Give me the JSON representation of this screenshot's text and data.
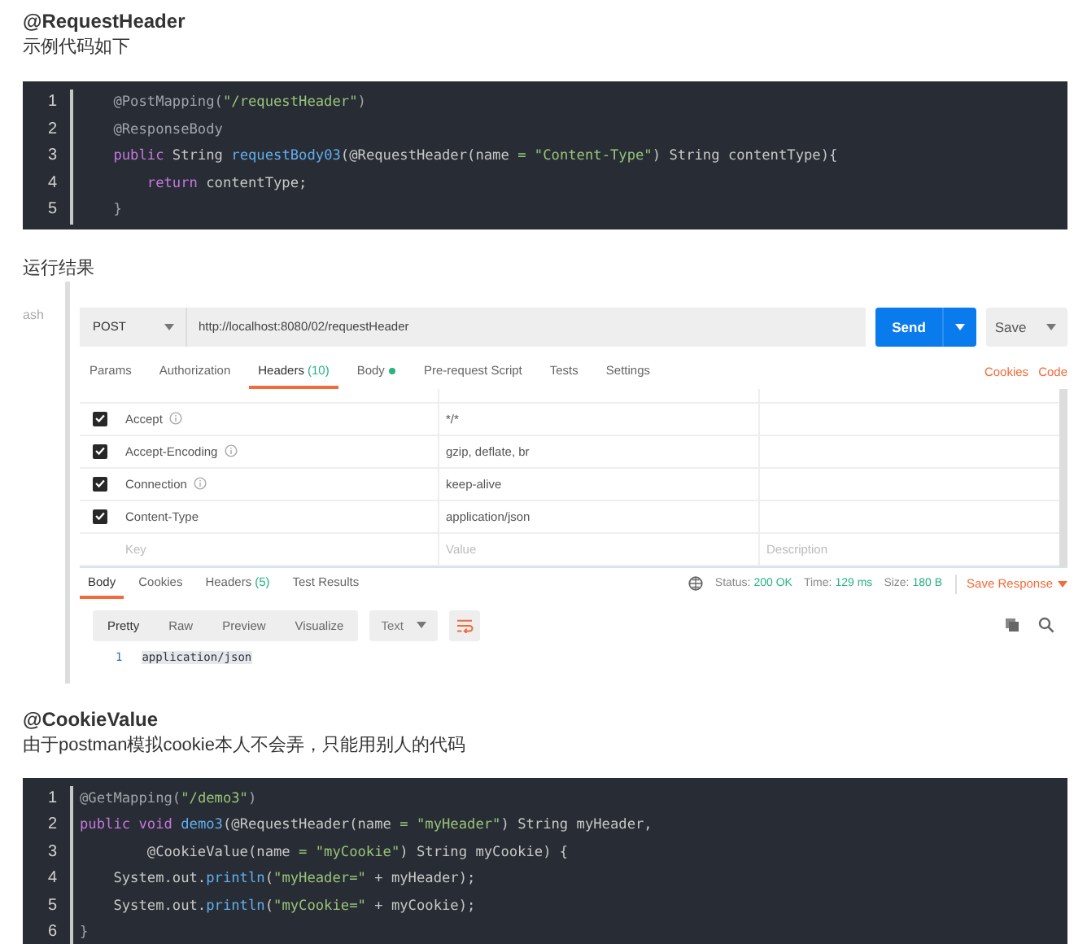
{
  "section1": {
    "heading": "@RequestHeader",
    "intro": "示例代码如下",
    "code": [
      {
        "n": "1",
        "tokens": [
          {
            "t": "    @PostMapping(",
            "kind": "annotation"
          },
          {
            "t": "\"/requestHeader\"",
            "kind": "string"
          },
          {
            "t": ")",
            "kind": "annotation"
          }
        ]
      },
      {
        "n": "2",
        "tokens": [
          {
            "t": "    @ResponseBody",
            "kind": "annotation"
          }
        ]
      },
      {
        "n": "3",
        "tokens": [
          {
            "t": "    public",
            "kind": "keyword"
          },
          {
            "t": " String ",
            "kind": "plain"
          },
          {
            "t": "requestBody03",
            "kind": "func"
          },
          {
            "t": "(@RequestHeader(name ",
            "kind": "plain"
          },
          {
            "t": "= \"Content-Type\"",
            "kind": "string"
          },
          {
            "t": ") String contentType){",
            "kind": "plain"
          }
        ]
      },
      {
        "n": "4",
        "tokens": [
          {
            "t": "        return",
            "kind": "keyword"
          },
          {
            "t": " contentType;",
            "kind": "plain"
          }
        ]
      },
      {
        "n": "5",
        "tokens": [
          {
            "t": "    }",
            "kind": "annotation"
          }
        ]
      }
    ]
  },
  "result_label": "运行结果",
  "postman": {
    "sidebar_text": "ash",
    "method": "POST",
    "url": "http://localhost:8080/02/requestHeader",
    "send": "Send",
    "save": "Save",
    "request_tabs": [
      {
        "label": "Params",
        "selected": false
      },
      {
        "label": "Authorization",
        "selected": false
      },
      {
        "label": "Headers",
        "count": "(10)",
        "selected": true
      },
      {
        "label": "Body",
        "dot": true,
        "selected": false
      },
      {
        "label": "Pre-request Script",
        "selected": false
      },
      {
        "label": "Tests",
        "selected": false
      },
      {
        "label": "Settings",
        "selected": false
      }
    ],
    "links": [
      "Cookies",
      "Code"
    ],
    "headers": [
      {
        "key": "Accept",
        "info": true,
        "value": "*/*",
        "checked": true
      },
      {
        "key": "Accept-Encoding",
        "info": true,
        "value": "gzip, deflate, br",
        "checked": true
      },
      {
        "key": "Connection",
        "info": true,
        "value": "keep-alive",
        "checked": true
      },
      {
        "key": "Content-Type",
        "info": false,
        "value": "application/json",
        "checked": true
      }
    ],
    "new_row": {
      "key_placeholder": "Key",
      "value_placeholder": "Value",
      "description_placeholder": "Description"
    },
    "response_tabs": [
      {
        "label": "Body",
        "selected": true
      },
      {
        "label": "Cookies",
        "selected": false
      },
      {
        "label": "Headers",
        "count": "(5)",
        "selected": false
      },
      {
        "label": "Test Results",
        "selected": false
      }
    ],
    "status": [
      {
        "label": "Status:",
        "value": "200 OK"
      },
      {
        "label": "Time:",
        "value": "129 ms"
      },
      {
        "label": "Size:",
        "value": "180 B"
      }
    ],
    "save_response": "Save Response",
    "view_modes": [
      {
        "label": "Pretty",
        "selected": true
      },
      {
        "label": "Raw",
        "selected": false
      },
      {
        "label": "Preview",
        "selected": false
      },
      {
        "label": "Visualize",
        "selected": false
      }
    ],
    "format": "Text",
    "body_lines": [
      {
        "n": "1",
        "text": "application/json"
      }
    ]
  },
  "section2": {
    "heading": "@CookieValue",
    "intro": "由于postman模拟cookie本人不会弄，只能用别人的代码",
    "code": [
      {
        "n": "1",
        "tokens": [
          {
            "t": "@GetMapping(",
            "kind": "annotation"
          },
          {
            "t": "\"/demo3\"",
            "kind": "string"
          },
          {
            "t": ")",
            "kind": "annotation"
          }
        ]
      },
      {
        "n": "2",
        "tokens": [
          {
            "t": "public void ",
            "kind": "keyword"
          },
          {
            "t": "demo3",
            "kind": "func"
          },
          {
            "t": "(@RequestHeader(name ",
            "kind": "plain"
          },
          {
            "t": "= \"myHeader\"",
            "kind": "string"
          },
          {
            "t": ") String myHeader,",
            "kind": "plain"
          }
        ]
      },
      {
        "n": "3",
        "tokens": [
          {
            "t": "        @CookieValue(name ",
            "kind": "plain"
          },
          {
            "t": "= \"myCookie\"",
            "kind": "string"
          },
          {
            "t": ") String myCookie) {",
            "kind": "plain"
          }
        ]
      },
      {
        "n": "4",
        "tokens": [
          {
            "t": "    System.out.",
            "kind": "plain"
          },
          {
            "t": "println",
            "kind": "func"
          },
          {
            "t": "(",
            "kind": "plain"
          },
          {
            "t": "\"myHeader=\"",
            "kind": "string"
          },
          {
            "t": " + myHeader);",
            "kind": "plain"
          }
        ]
      },
      {
        "n": "5",
        "tokens": [
          {
            "t": "    System.out.",
            "kind": "plain"
          },
          {
            "t": "println",
            "kind": "func"
          },
          {
            "t": "(",
            "kind": "plain"
          },
          {
            "t": "\"myCookie=\"",
            "kind": "string"
          },
          {
            "t": " + myCookie);",
            "kind": "plain"
          }
        ]
      },
      {
        "n": "6",
        "tokens": [
          {
            "t": "}",
            "kind": "annotation"
          }
        ]
      }
    ]
  }
}
